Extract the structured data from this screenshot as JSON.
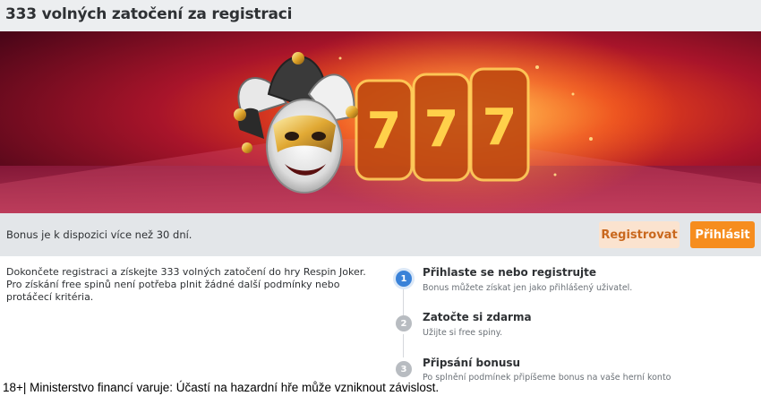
{
  "header": {
    "title": "333 volných zatočení za registraci"
  },
  "banner": {
    "slot_glyph": "7"
  },
  "bar": {
    "note": "Bonus je k dispozici více než 30 dní.",
    "register_label": "Registrovat",
    "login_label": "Přihlásit"
  },
  "description": "Dokončete registraci a získejte 333 volných zatočení do hry Respin Joker. Pro získání free spinů není potřeba plnit žádné další podmínky nebo protáčecí kritéria.",
  "steps": [
    {
      "number": "1",
      "title": "Přihlaste se nebo registrujte",
      "subtitle": "Bonus můžete získat jen jako přihlášený uživatel."
    },
    {
      "number": "2",
      "title": "Zatočte si zdarma",
      "subtitle": "Užijte si free spiny."
    },
    {
      "number": "3",
      "title": "Připsání bonusu",
      "subtitle": "Po splnění podmínek připíšeme bonus na vaše herní konto"
    }
  ],
  "footer": {
    "disclaimer": "18+| Ministerstvo financí varuje: Účastí na hazardní hře může vzniknout závislost."
  },
  "colors": {
    "accent": "#f68d1e",
    "accent_soft": "#fbe3cf",
    "step_active": "#3a82d8",
    "step_inactive": "#b8bcc1"
  }
}
